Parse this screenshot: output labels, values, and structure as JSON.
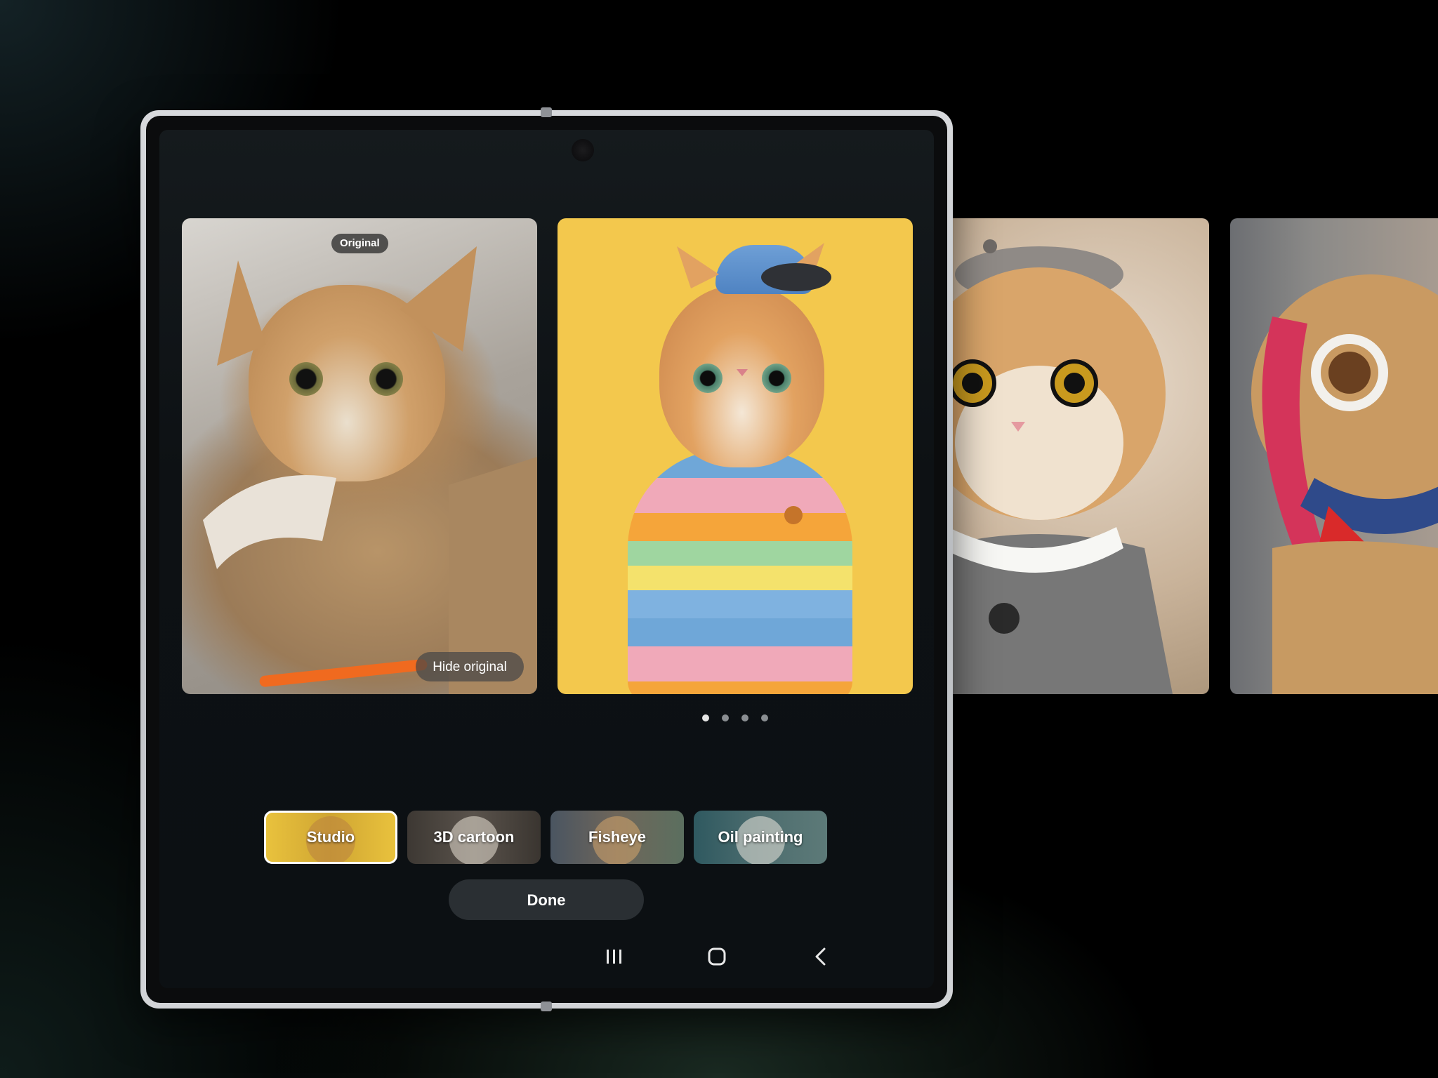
{
  "carousel": {
    "original_badge": "Original",
    "hide_original_label": "Hide original",
    "page_count": 4,
    "active_page": 1
  },
  "styles": [
    {
      "label": "Studio",
      "selected": true
    },
    {
      "label": "3D cartoon",
      "selected": false
    },
    {
      "label": "Fisheye",
      "selected": false
    },
    {
      "label": "Oil painting",
      "selected": false
    }
  ],
  "done_label": "Done",
  "nav": {
    "recents_icon": "recents-icon",
    "home_icon": "home-icon",
    "back_icon": "back-icon"
  },
  "colors": {
    "studio_background": "#f3c84d",
    "selected_chip_border": "#ffffff",
    "done_button": "#2a2f33"
  }
}
